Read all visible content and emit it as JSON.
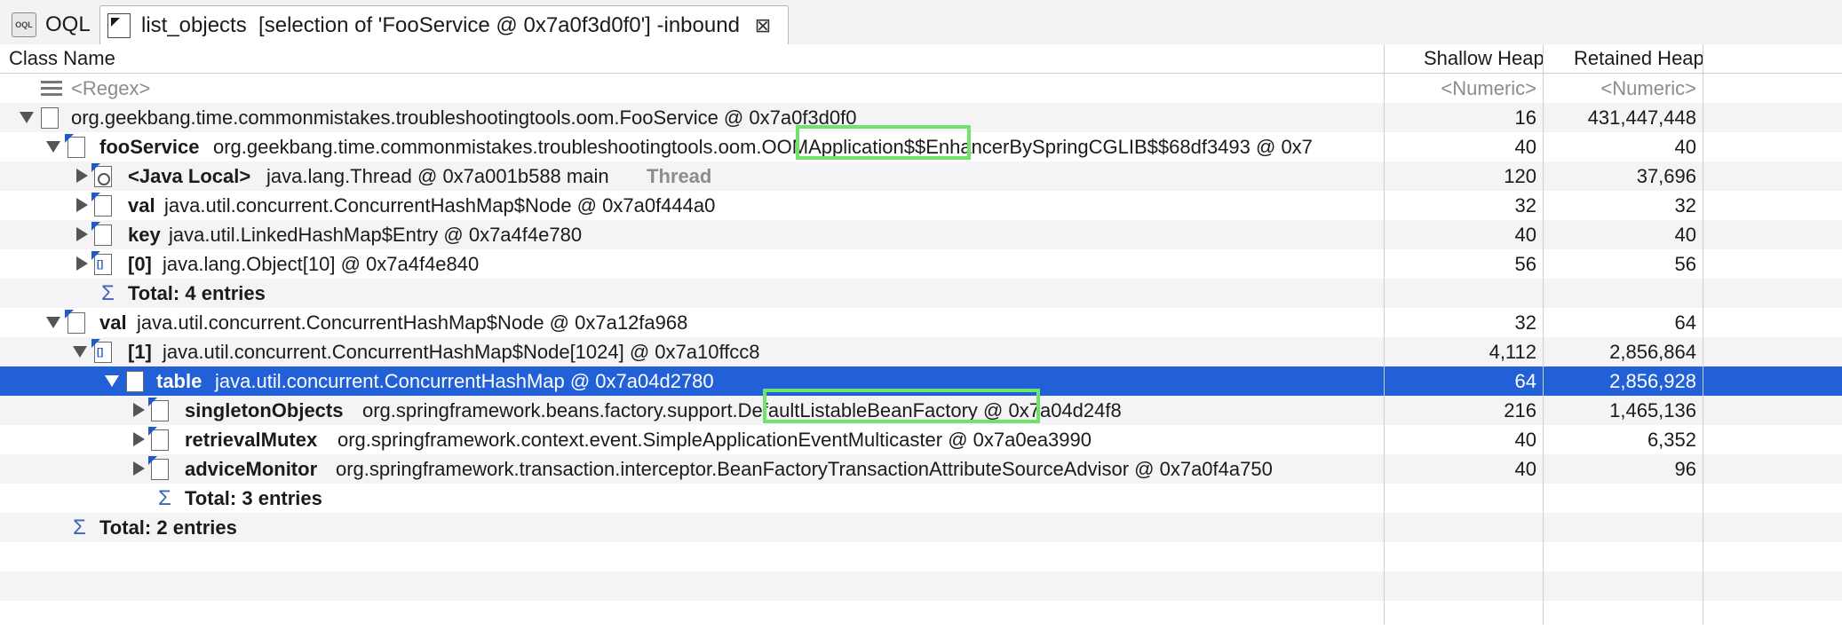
{
  "tabs": [
    {
      "label": "OQL",
      "icon": "oql-icon",
      "active": false
    },
    {
      "label": "list_objects  [selection of 'FooService @ 0x7a0f3d0f0'] -inbound",
      "icon": "list-objects-icon",
      "active": true
    }
  ],
  "columns": {
    "name": "Class Name",
    "shallow": "Shallow Heap",
    "retained": "Retained Heap"
  },
  "filter_row": {
    "name": "<Regex>",
    "shallow": "<Numeric>",
    "retained": "<Numeric>"
  },
  "rows": [
    {
      "field": "",
      "type": "org.geekbang.time.commonmistakes.troubleshootingtools.oom.FooService @ 0x7a0f3d0f0",
      "extra": "",
      "shallow": "16",
      "retained": "431,447,448"
    },
    {
      "field": "fooService",
      "type": "org.geekbang.time.commonmistakes.troubleshootingtools.oom.OOMApplication$$EnhancerBySpringCGLIB$$68df3493 @ 0x7",
      "extra": "",
      "shallow": "40",
      "retained": "40"
    },
    {
      "field": "<Java Local>",
      "type": "java.lang.Thread @ 0x7a001b588  main",
      "extra": "Thread",
      "shallow": "120",
      "retained": "37,696"
    },
    {
      "field": "val",
      "type": "java.util.concurrent.ConcurrentHashMap$Node @ 0x7a0f444a0",
      "extra": "",
      "shallow": "32",
      "retained": "32"
    },
    {
      "field": "key",
      "type": "java.util.LinkedHashMap$Entry @ 0x7a4f4e780",
      "extra": "",
      "shallow": "40",
      "retained": "40"
    },
    {
      "field": "[0]",
      "type": "java.lang.Object[10] @ 0x7a4f4e840",
      "extra": "",
      "shallow": "56",
      "retained": "56"
    },
    {
      "field": "Total: 4 entries",
      "type": "",
      "extra": "",
      "shallow": "",
      "retained": ""
    },
    {
      "field": "val",
      "type": "java.util.concurrent.ConcurrentHashMap$Node @ 0x7a12fa968",
      "extra": "",
      "shallow": "32",
      "retained": "64"
    },
    {
      "field": "[1]",
      "type": "java.util.concurrent.ConcurrentHashMap$Node[1024] @ 0x7a10ffcc8",
      "extra": "",
      "shallow": "4,112",
      "retained": "2,856,864"
    },
    {
      "field": "table",
      "type": "java.util.concurrent.ConcurrentHashMap @ 0x7a04d2780",
      "extra": "",
      "shallow": "64",
      "retained": "2,856,928"
    },
    {
      "field": "singletonObjects",
      "type": "org.springframework.beans.factory.support.DefaultListableBeanFactory @ 0x7a04d24f8",
      "extra": "",
      "shallow": "216",
      "retained": "1,465,136"
    },
    {
      "field": "retrievalMutex",
      "type": "org.springframework.context.event.SimpleApplicationEventMulticaster @ 0x7a0ea3990",
      "extra": "",
      "shallow": "40",
      "retained": "6,352"
    },
    {
      "field": "adviceMonitor",
      "type": "org.springframework.transaction.interceptor.BeanFactoryTransactionAttributeSourceAdvisor @ 0x7a0f4a750",
      "extra": "",
      "shallow": "40",
      "retained": "96"
    },
    {
      "field": "Total: 3 entries",
      "type": "",
      "extra": "",
      "shallow": "",
      "retained": ""
    },
    {
      "field": "Total: 2 entries",
      "type": "",
      "extra": "",
      "shallow": "",
      "retained": ""
    }
  ],
  "colors": {
    "selection": "#2160d7",
    "highlight_box": "#6fe36a"
  }
}
